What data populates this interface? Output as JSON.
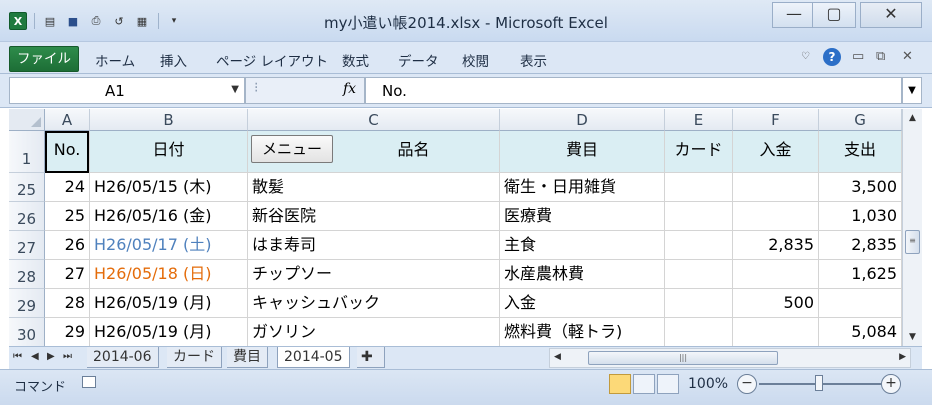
{
  "window": {
    "title": "my小遣い帳2014.xlsx - Microsoft Excel",
    "quick_access": [
      "excel-logo-icon",
      "save-icon",
      "print-preview-icon",
      "undo-icon",
      "form-icon",
      "customize-qat-icon"
    ],
    "controls": {
      "minimize": "—",
      "restore": "▢",
      "close": "✕"
    }
  },
  "ribbon": {
    "file_tab": "ファイル",
    "tabs": [
      "ホーム",
      "挿入",
      "ページ レイアウト",
      "数式",
      "データ",
      "校閲",
      "表示"
    ],
    "help": "?"
  },
  "formula_bar": {
    "name_box": "A1",
    "fx": "fx",
    "value": "No."
  },
  "grid": {
    "columns": [
      "A",
      "B",
      "C",
      "D",
      "E",
      "F",
      "G"
    ],
    "header_row": {
      "row_number": "1",
      "cells": [
        "No.",
        "日付",
        "品名",
        "費目",
        "カード",
        "入金",
        "支出"
      ],
      "menu_button": "メニュー"
    },
    "rows": [
      {
        "row_number": "25",
        "no": "24",
        "date": "H26/05/15 (木)",
        "item": "散髪",
        "category": "衛生・日用雑貨",
        "card": "",
        "income": "",
        "expense": "3,500",
        "day_type": "weekday"
      },
      {
        "row_number": "26",
        "no": "25",
        "date": "H26/05/16 (金)",
        "item": "新谷医院",
        "category": "医療費",
        "card": "",
        "income": "",
        "expense": "1,030",
        "day_type": "weekday"
      },
      {
        "row_number": "27",
        "no": "26",
        "date": "H26/05/17 (土)",
        "item": "はま寿司",
        "category": "主食",
        "card": "",
        "income": "2,835",
        "expense": "2,835",
        "day_type": "saturday"
      },
      {
        "row_number": "28",
        "no": "27",
        "date": "H26/05/18 (日)",
        "item": "チップソー",
        "category": "水産農林費",
        "card": "",
        "income": "",
        "expense": "1,625",
        "day_type": "sunday"
      },
      {
        "row_number": "29",
        "no": "28",
        "date": "H26/05/19 (月)",
        "item": "キャッシュバック",
        "category": "入金",
        "card": "",
        "income": "500",
        "expense": "",
        "day_type": "weekday"
      },
      {
        "row_number": "30",
        "no": "29",
        "date": "H26/05/19 (月)",
        "item": "ガソリン",
        "category": "燃料費（軽トラ)",
        "card": "",
        "income": "",
        "expense": "5,084",
        "day_type": "weekday"
      }
    ]
  },
  "sheets": {
    "tabs": [
      "2014-06",
      "カード",
      "費目",
      "2014-05"
    ],
    "active": "2014-05"
  },
  "status_bar": {
    "mode": "コマンド",
    "zoom": "100%"
  },
  "colors": {
    "header_fill": "#daeef3",
    "saturday": "#4f81bd",
    "sunday": "#e46c0a",
    "file_tab": "#1d6e36"
  }
}
